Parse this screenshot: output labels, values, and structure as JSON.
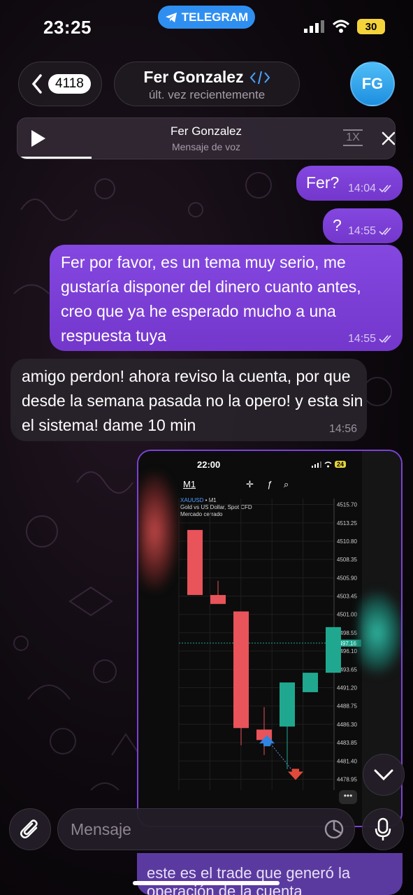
{
  "status_bar": {
    "time": "23:25",
    "app_pill": "TELEGRAM",
    "battery": "30"
  },
  "header": {
    "back_count": "4118",
    "title": "Fer Gonzalez",
    "subtitle": "últ. vez recientemente",
    "avatar_initials": "FG"
  },
  "voice_player": {
    "title": "Fer Gonzalez",
    "subtitle": "Mensaje de voz",
    "speed": "1X"
  },
  "messages": [
    {
      "text": "Fer?",
      "time": "14:04",
      "direction": "out"
    },
    {
      "text": "?",
      "time": "14:55",
      "direction": "out"
    },
    {
      "text": "Fer por favor, es un tema muy serio, me gustaría disponer del dinero cuanto antes, creo que ya he esperado mucho a una respuesta tuya",
      "time": "14:55",
      "direction": "out"
    },
    {
      "text": "amigo perdon! ahora reviso la cuenta, por que desde la semana pasada no la opero! y esta sin el sistema! dame 10 min",
      "time": "14:56",
      "direction": "in"
    }
  ],
  "image_message": {
    "shot_time": "22:00",
    "shot_battery": "24",
    "timeframe": "M1",
    "symbol": "XAUUSD",
    "symbol_suffix": " • M1",
    "description": "Gold vs US Dollar, Spot CFD",
    "market_status": "Mercado cerrado",
    "price_labels": [
      "4515.70",
      "4513.25",
      "4510.80",
      "4508.35",
      "4505.90",
      "4503.45",
      "4501.00",
      "4498.55",
      "4496.10",
      "4493.65",
      "4491.20",
      "4488.75",
      "4486.30",
      "4483.85",
      "4481.40",
      "4478.95"
    ],
    "current_price": "4497.16",
    "caption": "este es el trade que generó la operación de la cuenta"
  },
  "chart_data": {
    "type": "candlestick",
    "symbol": "XAUUSD",
    "timeframe": "M1",
    "ylim": [
      4477.5,
      4516.5
    ],
    "current_price": 4497.16,
    "candles": [
      {
        "open": 4512.3,
        "close": 4503.6,
        "high": 4512.3,
        "low": 4503.6,
        "direction": "down"
      },
      {
        "open": 4503.6,
        "close": 4502.4,
        "high": 4505.5,
        "low": 4502.4,
        "direction": "down"
      },
      {
        "open": 4501.4,
        "close": 4485.8,
        "high": 4501.4,
        "low": 4483.5,
        "direction": "down"
      },
      {
        "open": 4485.6,
        "close": 4484.2,
        "high": 4488.6,
        "low": 4482.2,
        "direction": "down"
      },
      {
        "open": 4486.0,
        "close": 4491.9,
        "high": 4491.9,
        "low": 4480.3,
        "direction": "up"
      },
      {
        "open": 4490.6,
        "close": 4493.2,
        "high": 4493.2,
        "low": 4490.6,
        "direction": "up"
      },
      {
        "open": 4493.2,
        "close": 4499.3,
        "high": 4499.3,
        "low": 4493.2,
        "direction": "up"
      }
    ],
    "markers": [
      {
        "type": "buy",
        "color": "#2f86e0",
        "price": 4484.3
      },
      {
        "type": "sell",
        "color": "#e04a3a",
        "price": 4479.6
      }
    ]
  },
  "composer": {
    "placeholder": "Mensaje"
  },
  "colors": {
    "outgoing_bubble": "#7c42d6",
    "incoming_bubble": "#28222a",
    "telegram_blue": "#2f8ff0",
    "bear_candle": "#e9535a",
    "bull_candle": "#1fa88f"
  }
}
